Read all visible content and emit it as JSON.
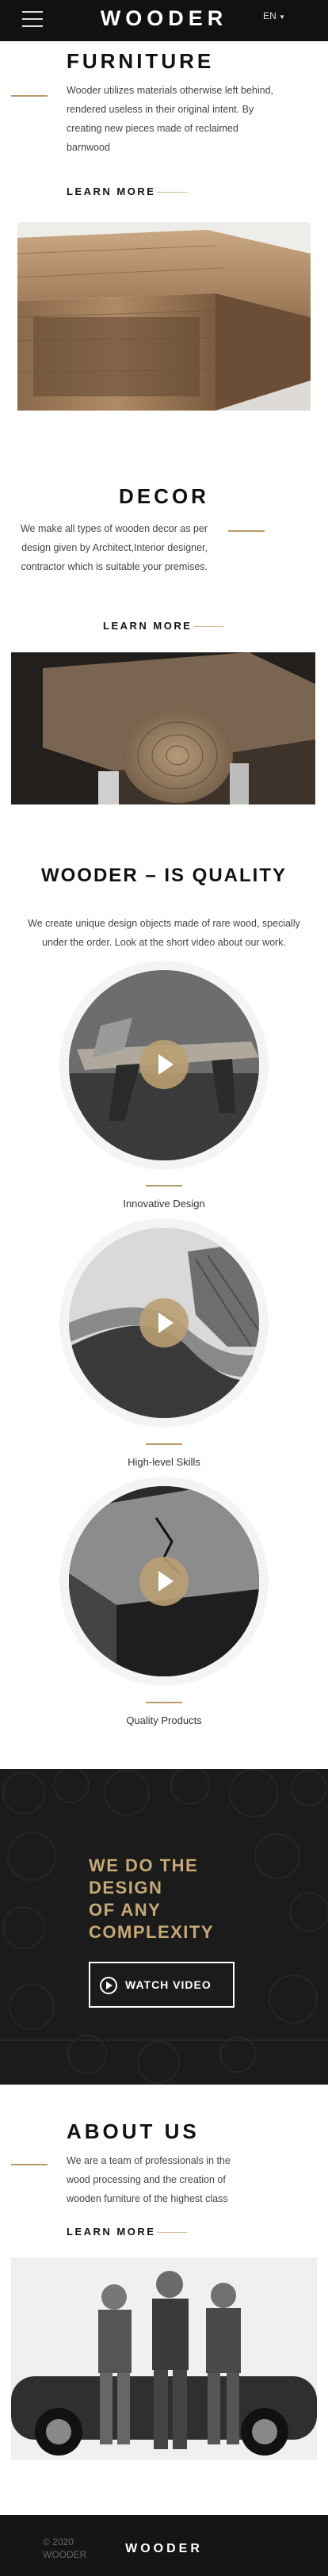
{
  "header": {
    "logo": "WOODER",
    "language": "EN"
  },
  "furniture": {
    "title": "FURNITURE",
    "text": "Wooder utilizes materials otherwise left behind, rendered useless in their original intent. By creating new pieces made of reclaimed barnwood",
    "learn_more": "LEARN MORE"
  },
  "decor": {
    "title": "DECOR",
    "text": "We make all types of wooden decor as per design given by Architect,Interior designer, contractor which is suitable your premises.",
    "learn_more": "LEARN MORE"
  },
  "quality": {
    "title": "WOODER – IS QUALITY",
    "intro": "We create unique design objects made of rare wood, specially under the order. Look at the short video about our work.",
    "items": [
      {
        "caption": "Innovative Design"
      },
      {
        "caption": "High-level Skills"
      },
      {
        "caption": "Quality Products"
      }
    ]
  },
  "banner": {
    "line1": "WE DO THE",
    "line2": "DESIGN",
    "line3": "OF ANY",
    "line4": "COMPLEXITY",
    "button": "WATCH VIDEO"
  },
  "about": {
    "title": "ABOUT US",
    "text": "We are a team of professionals in the wood processing and the creation of wooden furniture of the highest class",
    "learn_more": "LEARN MORE"
  },
  "footer": {
    "copyright_year": "© 2020",
    "copyright_name": "WOODER",
    "logo": "WOODER"
  },
  "colors": {
    "accent": "#b99a6a",
    "dark": "#191919",
    "banner_text": "#c6a876"
  }
}
